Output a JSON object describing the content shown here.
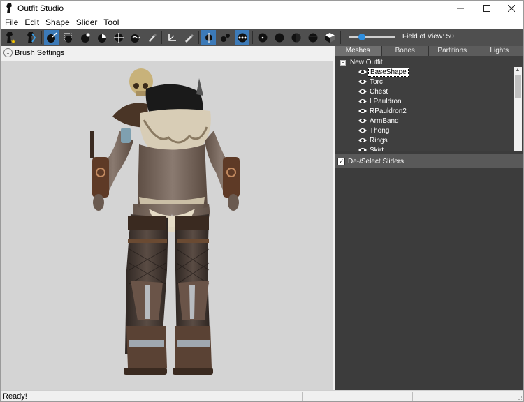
{
  "window": {
    "title": "Outfit Studio"
  },
  "menu": [
    "File",
    "Edit",
    "Shape",
    "Slider",
    "Tool"
  ],
  "toolbar": {
    "fov_label": "Field of View: 50",
    "fov_value": 0.25
  },
  "brush": {
    "label": "Brush Settings"
  },
  "tabs": [
    {
      "label": "Meshes",
      "active": true
    },
    {
      "label": "Bones",
      "active": false
    },
    {
      "label": "Partitions",
      "active": false
    },
    {
      "label": "Lights",
      "active": false
    }
  ],
  "tree": {
    "root": "New Outfit",
    "items": [
      "BaseShape",
      "Torc",
      "Chest",
      "LPauldron",
      "RPauldron2",
      "ArmBand",
      "Thong",
      "Rings",
      "Skirt"
    ],
    "selected": "BaseShape"
  },
  "sliders": {
    "header": "De-/Select Sliders"
  },
  "status": {
    "text": "Ready!"
  },
  "colors": {
    "toolbar_bg": "#4f4f4f",
    "accent": "#3c7ab8",
    "panel_bg": "#3c3c3c",
    "viewport_bg": "#d4d4d4"
  }
}
